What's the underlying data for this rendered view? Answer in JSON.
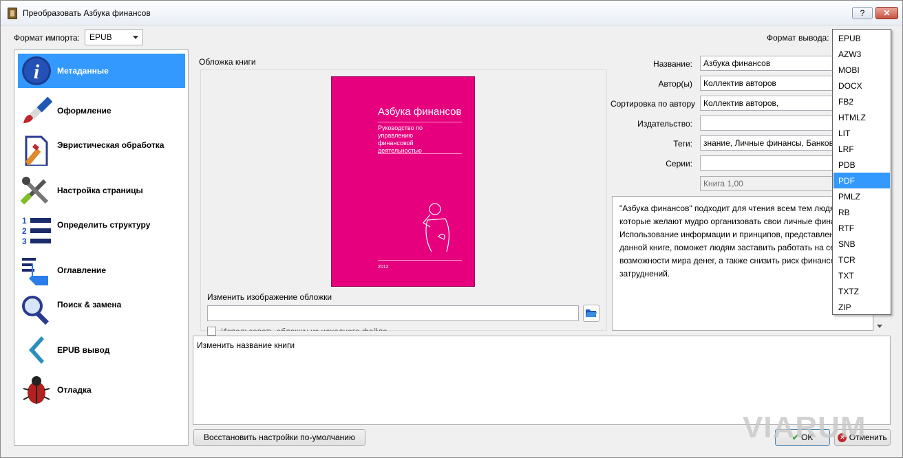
{
  "window": {
    "title": "Преобразовать Азбука финансов",
    "help_label": "?",
    "close_label": "✕"
  },
  "import_format": {
    "label": "Формат импорта:",
    "value": "EPUB"
  },
  "output_format": {
    "label": "Формат вывода:",
    "value": "EPUB",
    "options": [
      "EPUB",
      "AZW3",
      "MOBI",
      "DOCX",
      "FB2",
      "HTMLZ",
      "LIT",
      "LRF",
      "PDB",
      "PDF",
      "PMLZ",
      "RB",
      "RTF",
      "SNB",
      "TCR",
      "TXT",
      "TXTZ",
      "ZIP"
    ],
    "highlighted": "PDF"
  },
  "sidebar": {
    "items": [
      {
        "label": "Метаданные",
        "icon": "info-icon",
        "selected": true
      },
      {
        "label": "Оформление",
        "icon": "paintbrush-icon"
      },
      {
        "label": "Эвристическая обработка",
        "icon": "document-pen-icon"
      },
      {
        "label": "Настройка страницы",
        "icon": "tools-icon"
      },
      {
        "label": "Определить структуру",
        "icon": "numbered-list-icon"
      },
      {
        "label": "Оглавление",
        "icon": "toc-hand-icon"
      },
      {
        "label": "Поиск & замена",
        "icon": "magnifier-icon"
      },
      {
        "label": "EPUB вывод",
        "icon": "chevron-left-icon"
      },
      {
        "label": "Отладка",
        "icon": "bug-icon"
      }
    ]
  },
  "cover": {
    "group_label": "Обложка книги",
    "book_title": "Азбука финансов",
    "book_subtitle": "Руководство по управлению финансовой деятельностью",
    "book_year": "2012",
    "change_label": "Изменить изображение обложки",
    "path_value": "",
    "checkbox_label": "Использовать обложку из исходного файла"
  },
  "metadata": {
    "title": {
      "label": "Название:",
      "value": "Азбука финансов"
    },
    "authors": {
      "label": "Автор(ы)",
      "value": "Коллектив авторов"
    },
    "author_sort": {
      "label": "Сортировка по автору",
      "value": "Коллектив авторов,"
    },
    "publisher": {
      "label": "Издательство:",
      "value": ""
    },
    "tags": {
      "label": "Теги:",
      "value": "знание, Личные финансы, Банковское"
    },
    "series": {
      "label": "Серии:",
      "value": ""
    },
    "series_index": "Книга 1,00",
    "description": "\"Азбука финансов\" подходит для чтения всем тем людям, которые желают мудро организовать свои личные финансы. Использование информации и принципов, представленных в данной книге, поможет людям заставить работать на себя возможности мира денег, а также снизить риск финансовых затруднений."
  },
  "help_text": "Изменить название книги",
  "buttons": {
    "restore": "Восстановить настройки по-умолчанию",
    "ok": "OK",
    "cancel": "Отменить"
  },
  "watermark": "VIARUM",
  "colors": {
    "selection": "#3399ff",
    "cover": "#e6007e"
  }
}
